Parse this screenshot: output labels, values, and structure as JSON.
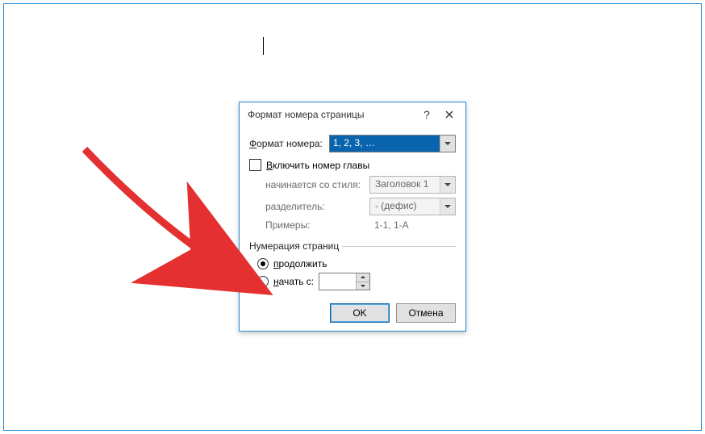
{
  "dialog": {
    "title": "Формат номера страницы",
    "format_label_prefix": "Ф",
    "format_label_rest": "ормат номера:",
    "format_value": "1, 2, 3, …",
    "include_chapter_prefix": "В",
    "include_chapter_rest": "ключить номер главы",
    "include_chapter_checked": false,
    "style_label": "начинается со стиля:",
    "style_value": "Заголовок 1",
    "separator_label": "разделитель:",
    "separator_value": "-   (дефис)",
    "examples_label": "Примеры:",
    "examples_value": "1-1, 1-A",
    "numbering_legend": "Нумерация страниц",
    "continue_hot": "п",
    "continue_rest": "родолжить",
    "start_hot": "н",
    "start_rest": "ачать с:",
    "start_value": "",
    "selected_radio": "continue",
    "ok_label": "OK",
    "cancel_label": "Отмена"
  }
}
